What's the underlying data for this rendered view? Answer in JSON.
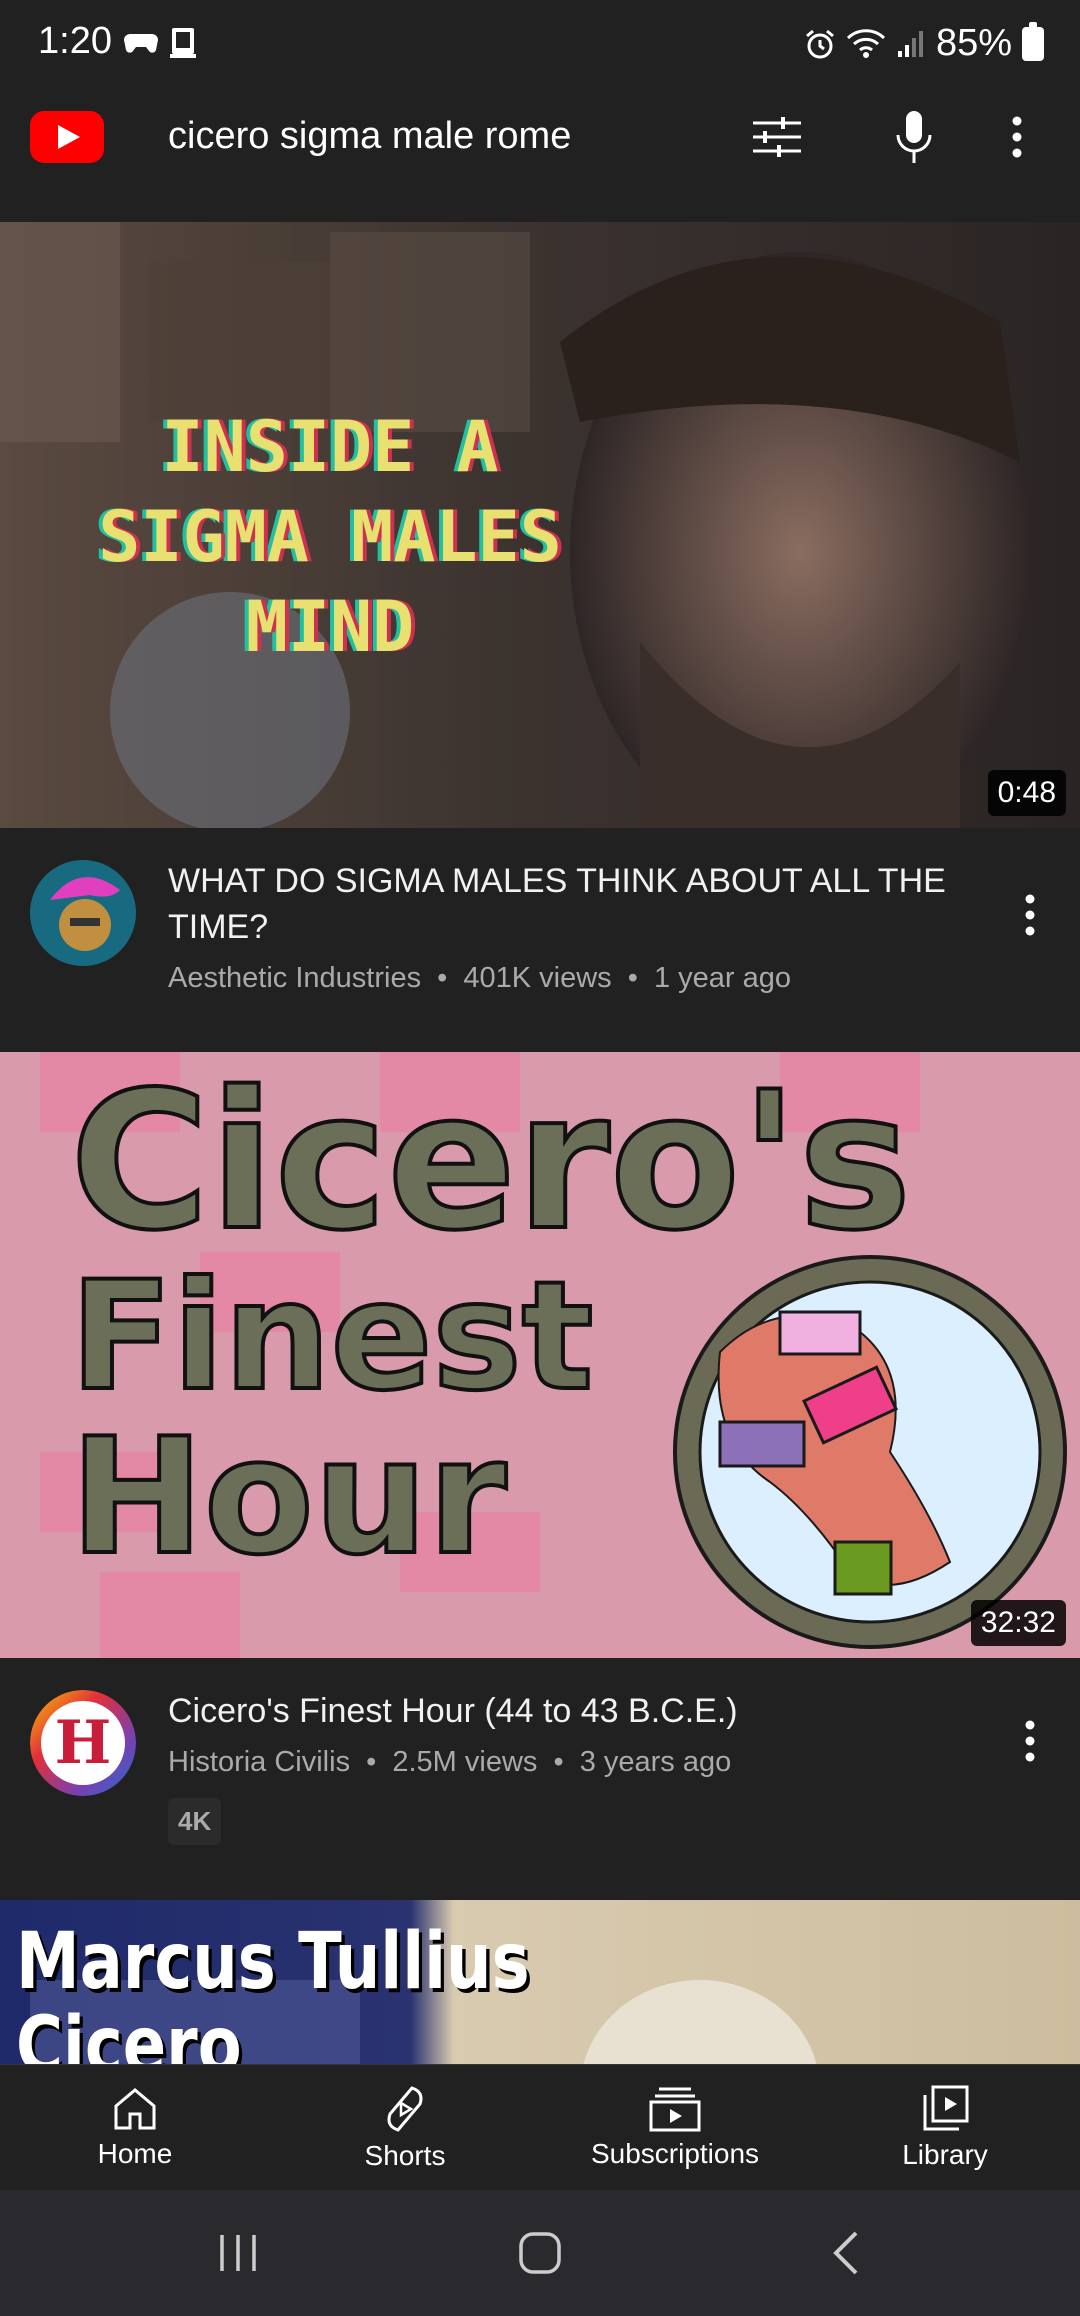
{
  "status_bar": {
    "time": "1:20",
    "battery": "85%"
  },
  "search": {
    "query": "cicero sigma male rome"
  },
  "videos": [
    {
      "thumb_text": [
        "INSIDE A",
        "SIGMA MALES",
        "MIND"
      ],
      "duration": "0:48",
      "title": "WHAT DO SIGMA MALES THINK ABOUT ALL THE TIME?",
      "channel": "Aesthetic Industries",
      "views": "401K views",
      "age": "1 year ago"
    },
    {
      "thumb_text": [
        "Cicero's",
        "Finest",
        "Hour"
      ],
      "duration": "32:32",
      "title": "Cicero's Finest Hour (44 to 43 B.C.E.)",
      "channel": "Historia Civilis",
      "views": "2.5M views",
      "age": "3 years ago",
      "badge": "4K",
      "avatar_letter": "H"
    },
    {
      "thumb_text": [
        "Marcus Tullius",
        "Cicero"
      ]
    }
  ],
  "separator": "•",
  "bottom_nav": {
    "home": "Home",
    "shorts": "Shorts",
    "subscriptions": "Subscriptions",
    "library": "Library"
  },
  "colors": {
    "background": "#212121",
    "brand_red": "#ff0000",
    "secondary_text": "#aaaaaa"
  }
}
